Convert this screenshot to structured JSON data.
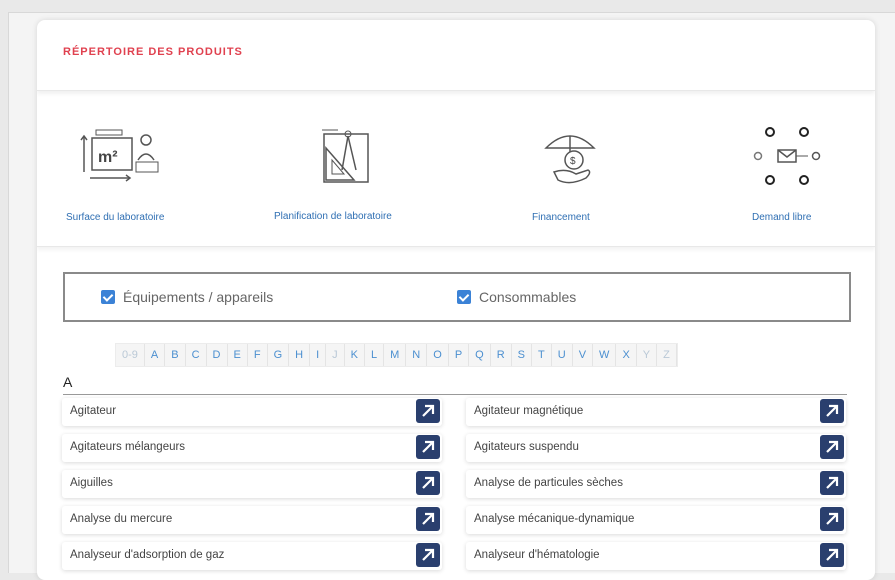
{
  "card": {
    "title": "RÉPERTOIRE DES PRODUITS"
  },
  "services": [
    {
      "label": "Surface du laboratoire",
      "icon": "lab-surface-icon"
    },
    {
      "label": "Planification de laboratoire",
      "icon": "lab-planning-icon"
    },
    {
      "label": "Financement",
      "icon": "financing-icon"
    },
    {
      "label": "Demand libre",
      "icon": "free-request-icon"
    }
  ],
  "filters": {
    "equipment": {
      "label": "Équipements / appareils",
      "checked": true
    },
    "consumables": {
      "label": "Consommables",
      "checked": true
    }
  },
  "alphabet": [
    {
      "l": "0-9",
      "active": false
    },
    {
      "l": "A",
      "active": true
    },
    {
      "l": "B",
      "active": true
    },
    {
      "l": "C",
      "active": true
    },
    {
      "l": "D",
      "active": true
    },
    {
      "l": "E",
      "active": true
    },
    {
      "l": "F",
      "active": true
    },
    {
      "l": "G",
      "active": true
    },
    {
      "l": "H",
      "active": true
    },
    {
      "l": "I",
      "active": true
    },
    {
      "l": "J",
      "active": false
    },
    {
      "l": "K",
      "active": true
    },
    {
      "l": "L",
      "active": true
    },
    {
      "l": "M",
      "active": true
    },
    {
      "l": "N",
      "active": true
    },
    {
      "l": "O",
      "active": true
    },
    {
      "l": "P",
      "active": true
    },
    {
      "l": "Q",
      "active": true
    },
    {
      "l": "R",
      "active": true
    },
    {
      "l": "S",
      "active": true
    },
    {
      "l": "T",
      "active": true
    },
    {
      "l": "U",
      "active": true
    },
    {
      "l": "V",
      "active": true
    },
    {
      "l": "W",
      "active": true
    },
    {
      "l": "X",
      "active": true
    },
    {
      "l": "Y",
      "active": false
    },
    {
      "l": "Z",
      "active": false
    }
  ],
  "section": {
    "letter": "A"
  },
  "products": {
    "left": [
      "Agitateur",
      "Agitateurs mélangeurs",
      "Aiguilles",
      "Analyse du mercure",
      "Analyseur d'adsorption de gaz"
    ],
    "right": [
      "Agitateur magnétique",
      "Agitateurs suspendu",
      "Analyse de particules sèches",
      "Analyse mécanique-dynamique",
      "Analyseur d'hématologie"
    ]
  },
  "colors": {
    "title": "#e0414f",
    "link": "#2f6fb3",
    "accent_button": "#2a3f6e",
    "checkbox": "#3b82d6"
  }
}
